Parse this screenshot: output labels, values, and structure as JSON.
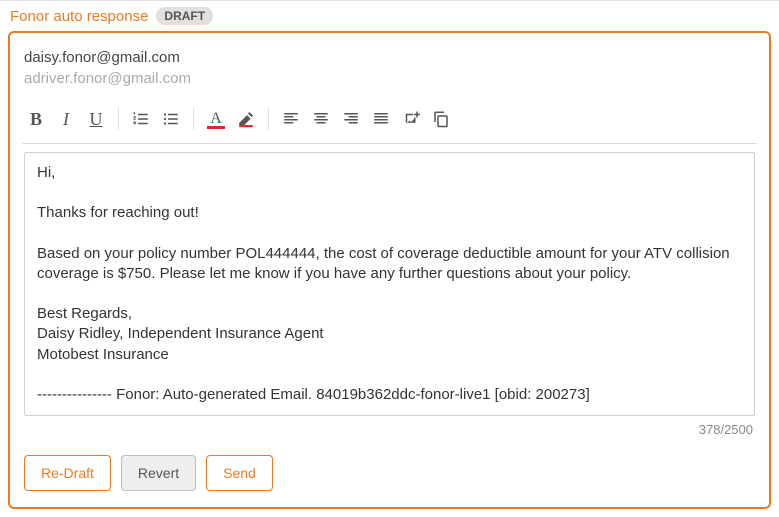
{
  "header": {
    "title": "Fonor auto response",
    "badge": "DRAFT"
  },
  "recipients": {
    "to": "daisy.fonor@gmail.com",
    "cc": "adriver.fonor@gmail.com"
  },
  "toolbar": {
    "bold": "B",
    "italic": "I",
    "underline": "U",
    "textcolor_glyph": "A"
  },
  "body": {
    "greeting": "Hi,",
    "thanks": "Thanks for reaching out!",
    "main": "Based on your policy number POL444444, the cost of coverage deductible amount for your ATV collision coverage is $750. Please let me know if you have any further questions about your policy.",
    "regards": "Best Regards,",
    "sig1": "Daisy Ridley, Independent Insurance Agent",
    "sig2": "Motobest Insurance",
    "footer": "--------------- Fonor: Auto-generated Email. 84019b362ddc-fonor-live1 [obid: 200273]"
  },
  "counter": "378/2500",
  "buttons": {
    "redraft": "Re-Draft",
    "revert": "Revert",
    "send": "Send"
  }
}
